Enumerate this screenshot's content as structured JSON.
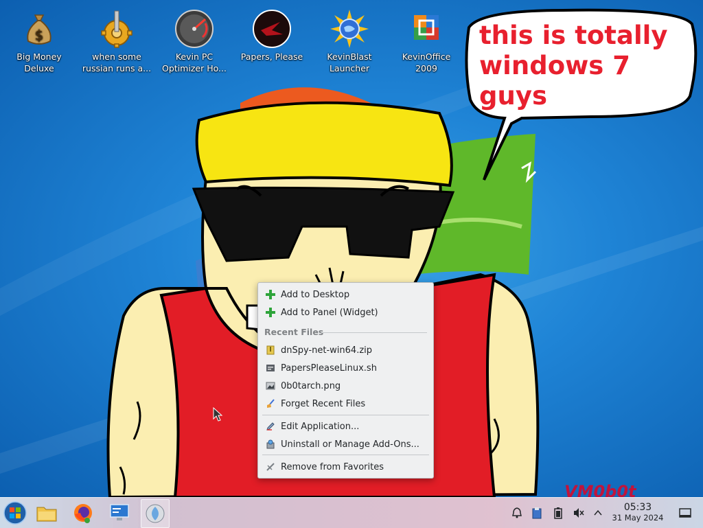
{
  "desktop_icons": [
    {
      "name": "Big Money Deluxe",
      "label": "Big Money\nDeluxe",
      "icon": "money-bag-icon"
    },
    {
      "name": "when some russian runs a",
      "label": "when some\nrussian runs a...",
      "icon": "gear-icon"
    },
    {
      "name": "Kevin PC Optimizer Ho",
      "label": "Kevin PC\nOptimizer Ho...",
      "icon": "gauge-icon"
    },
    {
      "name": "Papers, Please",
      "label": "Papers, Please",
      "icon": "papers-please-icon"
    },
    {
      "name": "KevinBlast Launcher",
      "label": "KevinBlast\nLauncher",
      "icon": "blast-globe-icon"
    },
    {
      "name": "KevinOffice 2009",
      "label": "KevinOffice\n2009",
      "icon": "office-icon"
    }
  ],
  "speech_bubble": {
    "text": "this is totally windows 7 guys"
  },
  "watermark": "VM0b0t",
  "context_menu": {
    "add_desktop": "Add to Desktop",
    "add_panel": "Add to Panel (Widget)",
    "recent_header": "Recent Files",
    "recent_files": [
      "dnSpy-net-win64.zip",
      "PapersPleaseLinux.sh",
      "0b0tarch.png"
    ],
    "forget": "Forget Recent Files",
    "edit_app": "Edit Application...",
    "uninstall": "Uninstall or Manage Add-Ons...",
    "remove_fav": "Remove from Favorites"
  },
  "taskbar": {
    "items": [
      "start-orb-icon",
      "file-manager-icon",
      "firefox-icon",
      "system-settings-icon",
      "discover-icon"
    ],
    "tray": [
      "notifications-icon",
      "clipboard-icon",
      "battery-icon",
      "volume-muted-icon",
      "chevron-up-icon"
    ],
    "clock": {
      "time": "05:33",
      "date": "31 May 2024"
    },
    "show_desktop": "show-desktop-icon"
  },
  "colors": {
    "bubble_text": "#e8202e",
    "menu_bg": "#eff0f1",
    "watermark": "#c0143c"
  }
}
